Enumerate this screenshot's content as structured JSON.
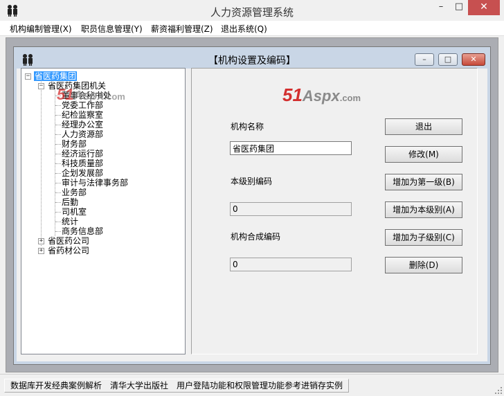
{
  "app": {
    "title": "人力资源管理系统"
  },
  "window_controls": {
    "minimize": "–",
    "maximize": "□",
    "close": "✕"
  },
  "menu": [
    "机构编制管理(X)",
    "职员信息管理(Y)",
    "薪资福利管理(Z)",
    "退出系统(Q)"
  ],
  "child_window": {
    "title": "【机构设置及编码】",
    "controls": {
      "minimize": "–",
      "maximize": "□",
      "close": "✕"
    }
  },
  "tree": {
    "root": "省医药集团",
    "level1": [
      "省医药集团机关",
      "省医药公司",
      "省药材公司"
    ],
    "departments": [
      "董事会秘书处",
      "党委工作部",
      "纪检监察室",
      "经理办公室",
      "人力资源部",
      "财务部",
      "经济运行部",
      "科技质量部",
      "企划发展部",
      "审计与法律事务部",
      "业务部",
      "后勤",
      "司机室",
      "统计",
      "商务信息部"
    ]
  },
  "watermark": {
    "num": "51",
    "aspx": "Aspx",
    "com": ".com"
  },
  "form": {
    "name_label": "机构名称",
    "name_value": "省医药集团",
    "level_code_label": "本级别编码",
    "level_code_value": "0",
    "combined_code_label": "机构合成编码",
    "combined_code_value": "0"
  },
  "buttons": {
    "exit": "退出",
    "modify": "修改(M)",
    "add_first_level": "增加为第一级(B)",
    "add_same_level": "增加为本级别(A)",
    "add_child_level": "增加为子级别(C)",
    "delete": "删除(D)"
  },
  "status": {
    "text": "数据库开发经典案例解析　清华大学出版社　用户登陆功能和权限管理功能参考进销存实例"
  },
  "colors": {
    "selection": "#3399ff",
    "close_button": "#c75050",
    "watermark_red": "#d32f2f"
  }
}
